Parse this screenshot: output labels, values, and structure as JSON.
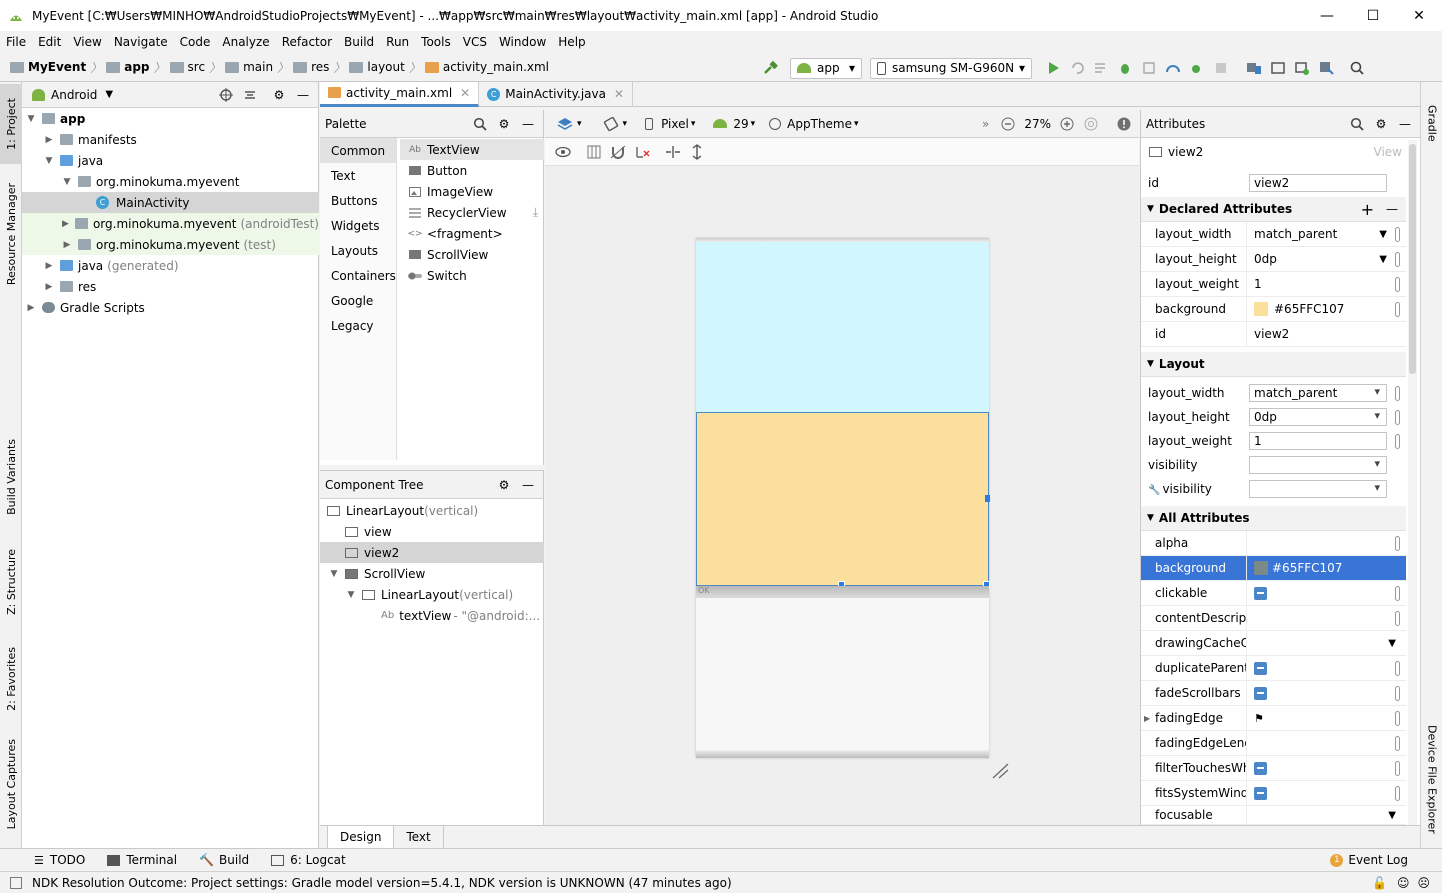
{
  "window": {
    "title": "MyEvent [C:₩Users₩MINHO₩AndroidStudioProjects₩MyEvent] - ...₩app₩src₩main₩res₩layout₩activity_main.xml [app] - Android Studio"
  },
  "menu": [
    "File",
    "Edit",
    "View",
    "Navigate",
    "Code",
    "Analyze",
    "Refactor",
    "Build",
    "Run",
    "Tools",
    "VCS",
    "Window",
    "Help"
  ],
  "breadcrumbs": [
    "MyEvent",
    "app",
    "src",
    "main",
    "res",
    "layout",
    "activity_main.xml"
  ],
  "toolbar": {
    "module": "app",
    "device": "samsung SM-G960N"
  },
  "left_tabs": [
    "1: Project",
    "Resource Manager",
    "Build Variants",
    "Z: Structure",
    "2: Favorites",
    "Layout Captures"
  ],
  "right_tabs": [
    "Gradle",
    "Device File Explorer"
  ],
  "project": {
    "view_mode": "Android",
    "tree": [
      {
        "label": "app",
        "bold": true
      },
      {
        "label": "manifests"
      },
      {
        "label": "java"
      },
      {
        "label": "org.minokuma.myevent"
      },
      {
        "label": "MainActivity"
      },
      {
        "label": "org.minokuma.myevent",
        "suffix": "(androidTest)"
      },
      {
        "label": "org.minokuma.myevent",
        "suffix": "(test)"
      },
      {
        "label": "java",
        "suffix": "(generated)"
      },
      {
        "label": "res"
      },
      {
        "label": "Gradle Scripts"
      }
    ]
  },
  "editor_tabs": [
    "activity_main.xml",
    "MainActivity.java"
  ],
  "palette": {
    "title": "Palette",
    "categories": [
      "Common",
      "Text",
      "Buttons",
      "Widgets",
      "Layouts",
      "Containers",
      "Google",
      "Legacy"
    ],
    "items": [
      "TextView",
      "Button",
      "ImageView",
      "RecyclerView",
      "<fragment>",
      "ScrollView",
      "Switch"
    ]
  },
  "component_tree": {
    "title": "Component Tree",
    "nodes": [
      {
        "label": "LinearLayout",
        "suffix": "(vertical)"
      },
      {
        "label": "view",
        "suffix": ""
      },
      {
        "label": "view2",
        "suffix": ""
      },
      {
        "label": "ScrollView",
        "suffix": ""
      },
      {
        "label": "LinearLayout",
        "suffix": "(vertical)"
      },
      {
        "label": "textView",
        "suffix": "- \"@android:..."
      }
    ]
  },
  "design_toolbar": {
    "device": "Pixel",
    "api": "29",
    "theme": "AppTheme",
    "zoom": "27%"
  },
  "canvas": {
    "view1_color": "#d1f6fd",
    "view2_color": "#fae09c",
    "scroll_label": "OK"
  },
  "attributes": {
    "title": "Attributes",
    "selected_view": "view2",
    "view_link": "View",
    "id_label": "id",
    "id_value": "view2",
    "declared_title": "Declared Attributes",
    "declared": [
      {
        "k": "layout_width",
        "v": "match_parent"
      },
      {
        "k": "layout_height",
        "v": "0dp"
      },
      {
        "k": "layout_weight",
        "v": "1"
      },
      {
        "k": "background",
        "v": "#65FFC107"
      },
      {
        "k": "id",
        "v": "view2"
      }
    ],
    "layout_title": "Layout",
    "layout": [
      {
        "k": "layout_width",
        "v": "match_parent"
      },
      {
        "k": "layout_height",
        "v": "0dp"
      },
      {
        "k": "layout_weight",
        "v": "1"
      },
      {
        "k": "visibility",
        "v": ""
      },
      {
        "k": "visibility",
        "v": ""
      }
    ],
    "all_title": "All Attributes",
    "all": [
      {
        "k": "alpha",
        "v": ""
      },
      {
        "k": "background",
        "v": "#65FFC107"
      },
      {
        "k": "clickable",
        "v": ""
      },
      {
        "k": "contentDescriptio",
        "v": ""
      },
      {
        "k": "drawingCacheQua",
        "v": ""
      },
      {
        "k": "duplicateParentSt",
        "v": ""
      },
      {
        "k": "fadeScrollbars",
        "v": ""
      },
      {
        "k": "fadingEdge",
        "v": ""
      },
      {
        "k": "fadingEdgeLength",
        "v": ""
      },
      {
        "k": "filterTouchesWhen",
        "v": ""
      },
      {
        "k": "fitsSystemWindow",
        "v": ""
      },
      {
        "k": "focusable",
        "v": ""
      }
    ]
  },
  "bottom_tabs": [
    "Design",
    "Text"
  ],
  "tool_windows": [
    "TODO",
    "Terminal",
    "Build",
    "6: Logcat"
  ],
  "event_log": {
    "count": "1",
    "label": "Event Log"
  },
  "status": "NDK Resolution Outcome: Project settings: Gradle model version=5.4.1, NDK version is UNKNOWN (47 minutes ago)"
}
